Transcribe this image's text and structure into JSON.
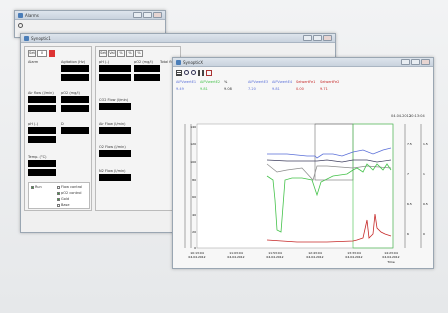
{
  "alarms_window": {
    "title": "Alarms"
  },
  "synoptic_window": {
    "title": "Synoptic1",
    "top_field": "Set",
    "top_value": "0",
    "labels": {
      "alarm": "Alarm",
      "agitation": "Agitation (Hz)",
      "airflow": "Air flow (l/min)",
      "po2": "pO2 (mg/l)",
      "ph": "pH (-)",
      "d_label": "D",
      "temp": "Temp. (°C)",
      "ph1": "pH (-)",
      "po2b": "pO2 (mg/l)",
      "total_flow": "Total flow (l/min)",
      "co2_flow": "CO2 Flow (l/min)",
      "air_flow2": "Air Flow (l/min)",
      "o2_flow": "O2 Flow (l/min)",
      "n2_flow": "N2 Flow (l/min)"
    },
    "legend": {
      "run": "Run",
      "flow_control": "Flow control",
      "po2_control": "pO2 control",
      "gold": "Gold",
      "base": "Base"
    },
    "tool_buttons": [
      "Set",
      "Val",
      "%",
      "%",
      "%"
    ]
  },
  "graph_window": {
    "title": "SynopticX",
    "series_headers": [
      "AiPVwertE1",
      "AiPVwertE2",
      "%",
      "AiPVwertE3",
      "AiPVwertE4",
      "SelwertFe1",
      "SelwertFe2"
    ],
    "series_values": [
      "9.49",
      "9.81",
      "9.08",
      "7.20",
      "9.81",
      "0.00",
      "9.71"
    ],
    "date_readout": "04.04.2012",
    "time_readout": "10:13:04",
    "x_ticks": [
      {
        "time": "10:13:04",
        "date": "04.04.2012"
      },
      {
        "time": "11:03:04",
        "date": "04.04.2012"
      },
      {
        "time": "11:53:04",
        "date": "04.04.2012"
      },
      {
        "time": "12:43:04",
        "date": "04.04.2012"
      },
      {
        "time": "13:33:04",
        "date": "04.04.2012"
      },
      {
        "time": "14:23:04",
        "date": "04.04.2012"
      }
    ],
    "x_axis_label": "Time",
    "y_ticks_left": [
      "140",
      "120",
      "100",
      "80",
      "60",
      "40",
      "20",
      "0"
    ],
    "y_ticks_right_a": [
      "7.5",
      "7",
      "6.5",
      "6"
    ],
    "y_ticks_right_b": [
      "1.5",
      "1",
      "0.5",
      "0"
    ],
    "colors": {
      "blue": "#5a6fd8",
      "green": "#44c24a",
      "red": "#c62828",
      "grey": "#8a8a8a",
      "dark": "#404060"
    }
  }
}
